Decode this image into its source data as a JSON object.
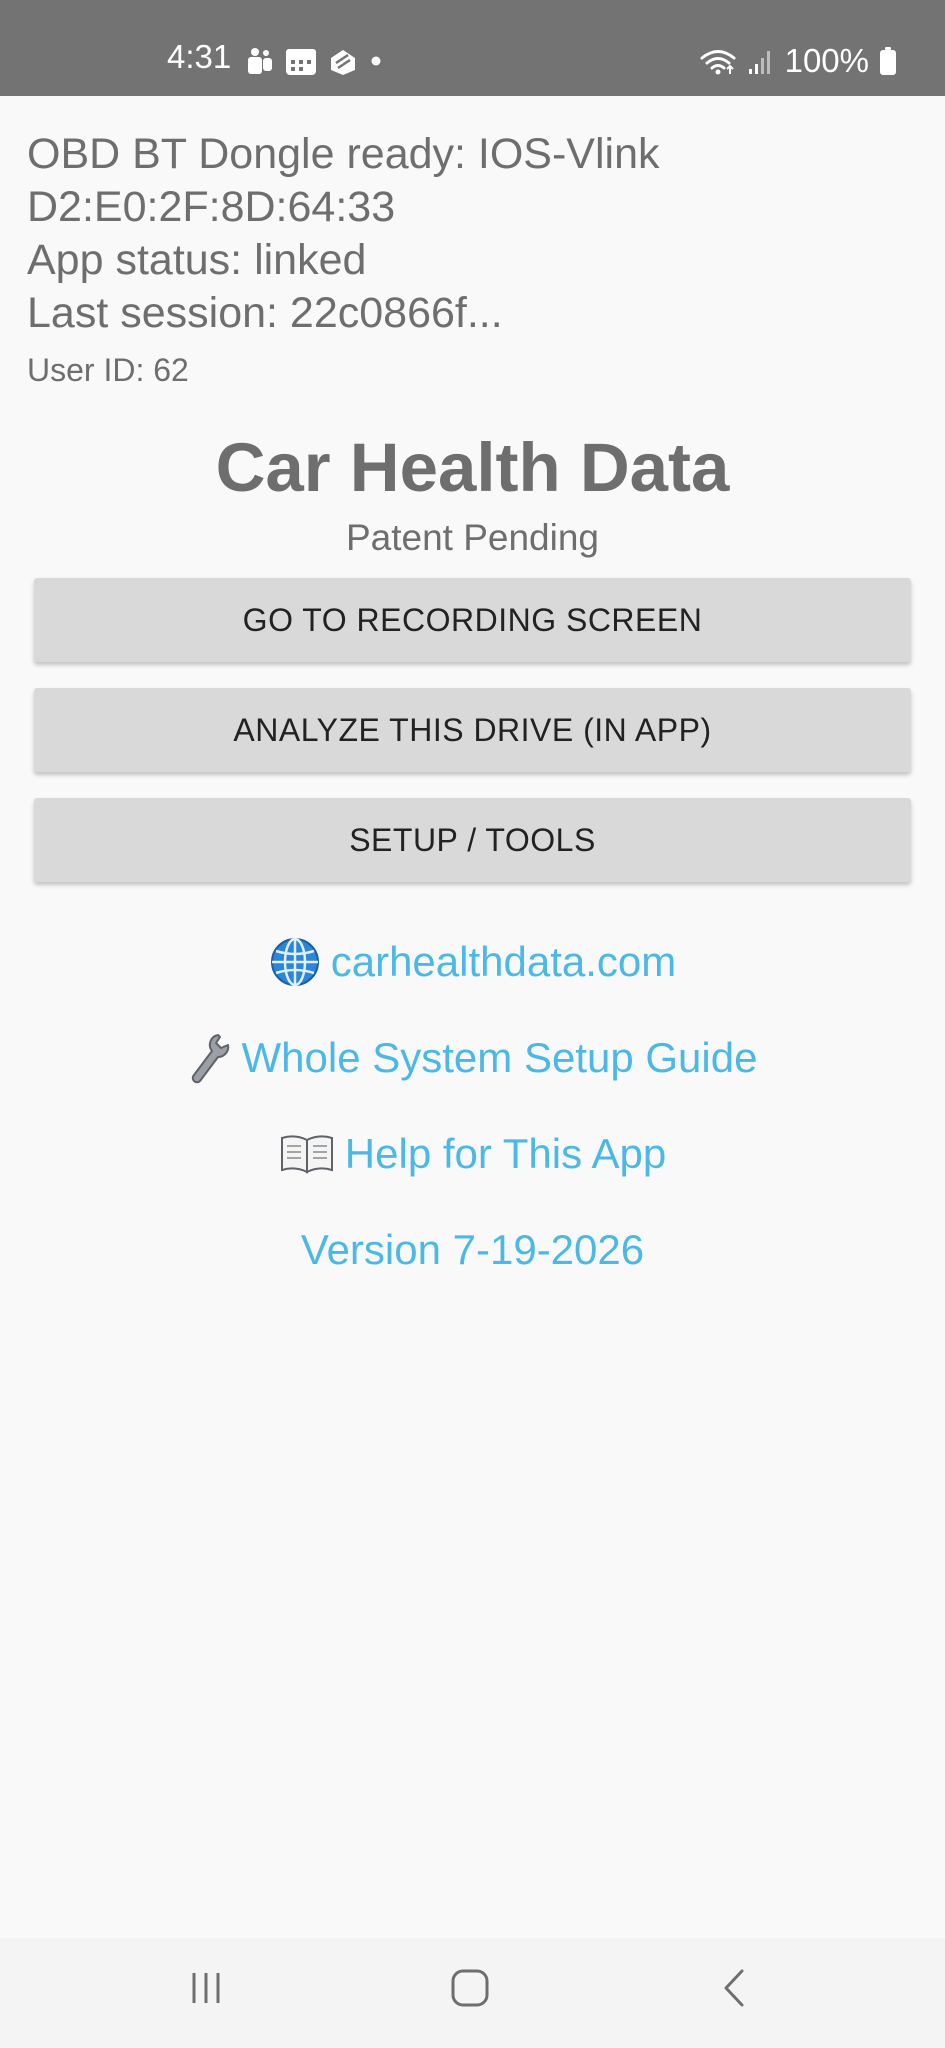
{
  "status_bar": {
    "time": "4:31",
    "left_icons": [
      "teams-icon",
      "calendar-icon",
      "app-icon",
      "notification-dot-icon"
    ],
    "right_icons": [
      "wifi-icon",
      "signal-icon",
      "battery-icon"
    ],
    "battery": "100%"
  },
  "info": {
    "dongle_line": "OBD BT Dongle ready: IOS-Vlink",
    "mac_line": "D2:E0:2F:8D:64:33",
    "app_status": "App status: linked",
    "last_session": "Last session: 22c0866f...",
    "user_id": "User ID: 62"
  },
  "header": {
    "title": "Car Health Data",
    "subtitle": "Patent Pending"
  },
  "buttons": {
    "recording": "GO TO RECORDING SCREEN",
    "analyze": "ANALYZE THIS DRIVE (IN APP)",
    "setup": "SETUP / TOOLS"
  },
  "links": {
    "website": "carhealthdata.com",
    "setup_guide": "Whole System Setup Guide",
    "help": "Help for This App",
    "version": "Version 7-19-2026"
  },
  "nav_bar": {
    "items": [
      "recent-apps-icon",
      "home-icon",
      "back-icon"
    ]
  },
  "colors": {
    "status_bar": "#737373",
    "background": "#f9f9f9",
    "text": "#6e6e6e",
    "button_bg": "#d9d9d9",
    "link": "#4cb8e6"
  }
}
